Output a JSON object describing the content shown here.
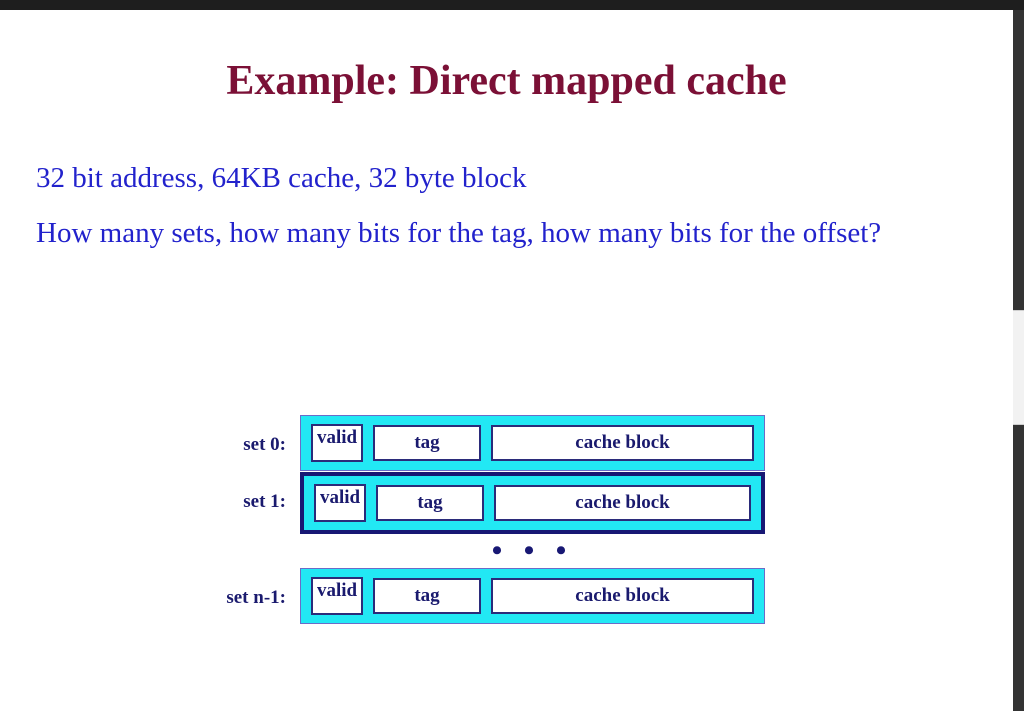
{
  "window": {
    "top_bar_color": "#1e1e1e",
    "rail_color": "#333333",
    "scrollbar_thumb_color": "#f2f2f2"
  },
  "slide": {
    "title": "Example: Direct mapped cache",
    "title_color": "#7B1036",
    "body_color": "#2222CC",
    "body_lines": [
      "32 bit address, 64KB cache, 32 byte block",
      "How many sets, how many bits for the tag, how many bits for the offset?"
    ]
  },
  "diagram": {
    "bar_color": "#22E8F4",
    "cell_border_color": "#2B2B7A",
    "label_color": "#1A1A6E",
    "highlight_border_color": "#181874",
    "ellipsis": "• • •",
    "rows": [
      {
        "label": "set 0:",
        "highlighted": false,
        "valid": "valid",
        "tag": "tag",
        "block": "cache block"
      },
      {
        "label": "set 1:",
        "highlighted": true,
        "valid": "valid",
        "tag": "tag",
        "block": "cache block"
      },
      {
        "label": "set n-1:",
        "highlighted": false,
        "valid": "valid",
        "tag": "tag",
        "block": "cache block"
      }
    ]
  }
}
